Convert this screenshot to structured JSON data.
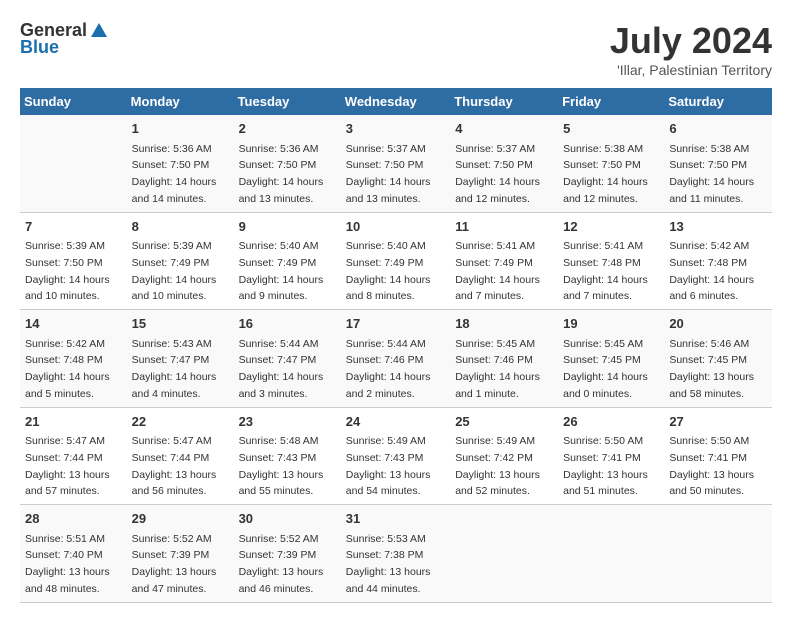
{
  "header": {
    "logo_general": "General",
    "logo_blue": "Blue",
    "month_title": "July 2024",
    "location": "'Illar, Palestinian Territory"
  },
  "weekdays": [
    "Sunday",
    "Monday",
    "Tuesday",
    "Wednesday",
    "Thursday",
    "Friday",
    "Saturday"
  ],
  "weeks": [
    [
      null,
      {
        "date": "1",
        "sunrise": "5:36 AM",
        "sunset": "7:50 PM",
        "daylight": "14 hours and 14 minutes."
      },
      {
        "date": "2",
        "sunrise": "5:36 AM",
        "sunset": "7:50 PM",
        "daylight": "14 hours and 13 minutes."
      },
      {
        "date": "3",
        "sunrise": "5:37 AM",
        "sunset": "7:50 PM",
        "daylight": "14 hours and 13 minutes."
      },
      {
        "date": "4",
        "sunrise": "5:37 AM",
        "sunset": "7:50 PM",
        "daylight": "14 hours and 12 minutes."
      },
      {
        "date": "5",
        "sunrise": "5:38 AM",
        "sunset": "7:50 PM",
        "daylight": "14 hours and 12 minutes."
      },
      {
        "date": "6",
        "sunrise": "5:38 AM",
        "sunset": "7:50 PM",
        "daylight": "14 hours and 11 minutes."
      }
    ],
    [
      {
        "date": "7",
        "sunrise": "5:39 AM",
        "sunset": "7:50 PM",
        "daylight": "14 hours and 10 minutes."
      },
      {
        "date": "8",
        "sunrise": "5:39 AM",
        "sunset": "7:49 PM",
        "daylight": "14 hours and 10 minutes."
      },
      {
        "date": "9",
        "sunrise": "5:40 AM",
        "sunset": "7:49 PM",
        "daylight": "14 hours and 9 minutes."
      },
      {
        "date": "10",
        "sunrise": "5:40 AM",
        "sunset": "7:49 PM",
        "daylight": "14 hours and 8 minutes."
      },
      {
        "date": "11",
        "sunrise": "5:41 AM",
        "sunset": "7:49 PM",
        "daylight": "14 hours and 7 minutes."
      },
      {
        "date": "12",
        "sunrise": "5:41 AM",
        "sunset": "7:48 PM",
        "daylight": "14 hours and 7 minutes."
      },
      {
        "date": "13",
        "sunrise": "5:42 AM",
        "sunset": "7:48 PM",
        "daylight": "14 hours and 6 minutes."
      }
    ],
    [
      {
        "date": "14",
        "sunrise": "5:42 AM",
        "sunset": "7:48 PM",
        "daylight": "14 hours and 5 minutes."
      },
      {
        "date": "15",
        "sunrise": "5:43 AM",
        "sunset": "7:47 PM",
        "daylight": "14 hours and 4 minutes."
      },
      {
        "date": "16",
        "sunrise": "5:44 AM",
        "sunset": "7:47 PM",
        "daylight": "14 hours and 3 minutes."
      },
      {
        "date": "17",
        "sunrise": "5:44 AM",
        "sunset": "7:46 PM",
        "daylight": "14 hours and 2 minutes."
      },
      {
        "date": "18",
        "sunrise": "5:45 AM",
        "sunset": "7:46 PM",
        "daylight": "14 hours and 1 minute."
      },
      {
        "date": "19",
        "sunrise": "5:45 AM",
        "sunset": "7:45 PM",
        "daylight": "14 hours and 0 minutes."
      },
      {
        "date": "20",
        "sunrise": "5:46 AM",
        "sunset": "7:45 PM",
        "daylight": "13 hours and 58 minutes."
      }
    ],
    [
      {
        "date": "21",
        "sunrise": "5:47 AM",
        "sunset": "7:44 PM",
        "daylight": "13 hours and 57 minutes."
      },
      {
        "date": "22",
        "sunrise": "5:47 AM",
        "sunset": "7:44 PM",
        "daylight": "13 hours and 56 minutes."
      },
      {
        "date": "23",
        "sunrise": "5:48 AM",
        "sunset": "7:43 PM",
        "daylight": "13 hours and 55 minutes."
      },
      {
        "date": "24",
        "sunrise": "5:49 AM",
        "sunset": "7:43 PM",
        "daylight": "13 hours and 54 minutes."
      },
      {
        "date": "25",
        "sunrise": "5:49 AM",
        "sunset": "7:42 PM",
        "daylight": "13 hours and 52 minutes."
      },
      {
        "date": "26",
        "sunrise": "5:50 AM",
        "sunset": "7:41 PM",
        "daylight": "13 hours and 51 minutes."
      },
      {
        "date": "27",
        "sunrise": "5:50 AM",
        "sunset": "7:41 PM",
        "daylight": "13 hours and 50 minutes."
      }
    ],
    [
      {
        "date": "28",
        "sunrise": "5:51 AM",
        "sunset": "7:40 PM",
        "daylight": "13 hours and 48 minutes."
      },
      {
        "date": "29",
        "sunrise": "5:52 AM",
        "sunset": "7:39 PM",
        "daylight": "13 hours and 47 minutes."
      },
      {
        "date": "30",
        "sunrise": "5:52 AM",
        "sunset": "7:39 PM",
        "daylight": "13 hours and 46 minutes."
      },
      {
        "date": "31",
        "sunrise": "5:53 AM",
        "sunset": "7:38 PM",
        "daylight": "13 hours and 44 minutes."
      },
      null,
      null,
      null
    ]
  ]
}
